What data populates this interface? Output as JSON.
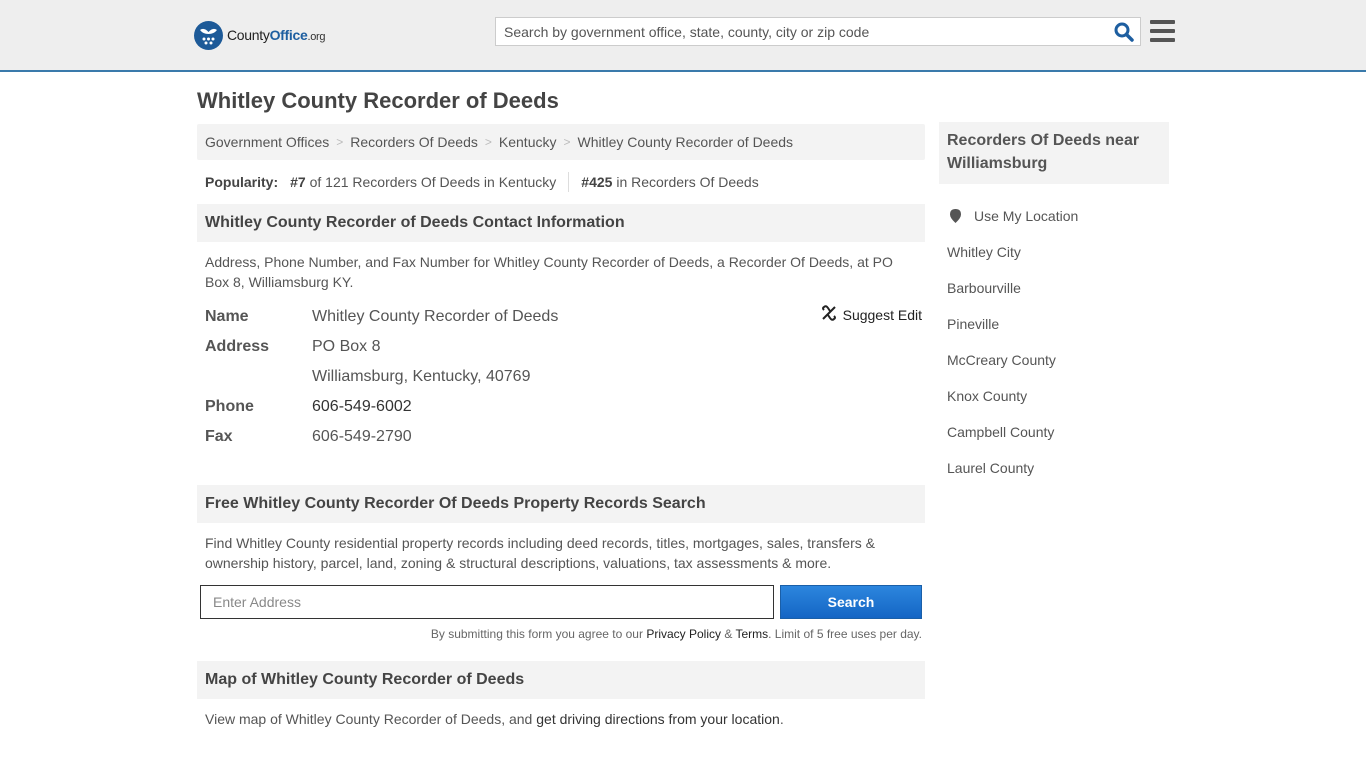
{
  "header": {
    "logo": {
      "prefix": "County",
      "brand": "Office",
      "suffix": ".org"
    },
    "search_placeholder": "Search by government office, state, county, city or zip code",
    "icons": {
      "search": "search-icon",
      "menu": "hamburger-menu-icon"
    }
  },
  "page_title": "Whitley County Recorder of Deeds",
  "breadcrumb": [
    {
      "label": "Government Offices"
    },
    {
      "label": "Recorders Of Deeds"
    },
    {
      "label": "Kentucky"
    },
    {
      "label": "Whitley County Recorder of Deeds"
    }
  ],
  "popularity": {
    "label": "Popularity:",
    "state_rank": "#7",
    "state_text": "of 121 Recorders Of Deeds in Kentucky",
    "national_rank": "#425",
    "national_text": "in Recorders Of Deeds"
  },
  "contact": {
    "heading": "Whitley County Recorder of Deeds Contact Information",
    "description": "Address, Phone Number, and Fax Number for Whitley County Recorder of Deeds, a Recorder Of Deeds, at PO Box 8, Williamsburg KY.",
    "suggest_edit": "Suggest Edit",
    "rows": [
      {
        "label": "Name",
        "value": "Whitley County Recorder of Deeds"
      },
      {
        "label": "Address",
        "value": "PO Box 8"
      },
      {
        "label": "",
        "value": "Williamsburg, Kentucky, 40769"
      },
      {
        "label": "Phone",
        "value": "606-549-6002"
      },
      {
        "label": "Fax",
        "value": "606-549-2790"
      }
    ]
  },
  "property_search": {
    "heading": "Free Whitley County Recorder Of Deeds Property Records Search",
    "description": "Find Whitley County residential property records including deed records, titles, mortgages, sales, transfers & ownership history, parcel, land, zoning & structural descriptions, valuations, tax assessments & more.",
    "input_placeholder": "Enter Address",
    "button_label": "Search",
    "disclaimer_prefix": "By submitting this form you agree to our ",
    "privacy_link": "Privacy Policy",
    "amp": " & ",
    "terms_link": "Terms",
    "disclaimer_suffix": ". Limit of 5 free uses per day."
  },
  "map": {
    "heading": "Map of Whitley County Recorder of Deeds",
    "text_prefix": "View map of Whitley County Recorder of Deeds, and ",
    "link": "get driving directions from your location",
    "text_suffix": "."
  },
  "sidebar": {
    "heading": "Recorders Of Deeds near Williamsburg",
    "use_location": "Use My Location",
    "items": [
      {
        "label": "Whitley City"
      },
      {
        "label": "Barbourville"
      },
      {
        "label": "Pineville"
      },
      {
        "label": "McCreary County"
      },
      {
        "label": "Knox County"
      },
      {
        "label": "Campbell County"
      },
      {
        "label": "Laurel County"
      }
    ]
  }
}
